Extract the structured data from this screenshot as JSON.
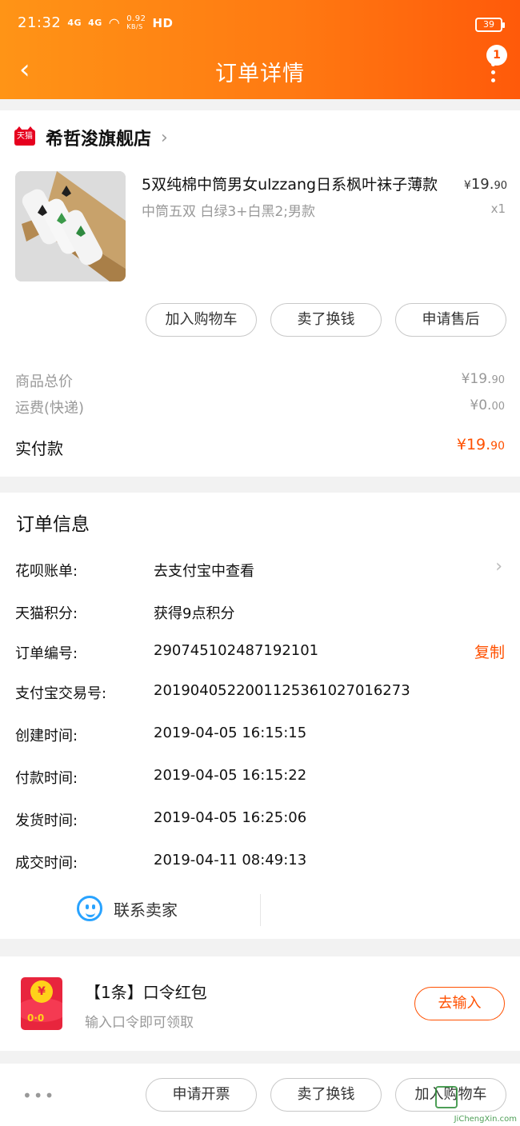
{
  "status_bar": {
    "time": "21:32",
    "signal1": "4G",
    "signal2": "4G",
    "net_speed_value": "0.92",
    "net_speed_unit": "KB/S",
    "hd": "HD",
    "battery": "39"
  },
  "header": {
    "title": "订单详情",
    "badge": "1"
  },
  "shop": {
    "tag": "天猫",
    "name": "希哲浚旗舰店"
  },
  "product": {
    "name": "5双纯棉中筒男女ulzzang日系枫叶袜子薄款",
    "sku": "中筒五双 白绿3+白黑2;男款",
    "price_symbol": "¥",
    "price_int": "19.",
    "price_dec": "90",
    "qty": "x1"
  },
  "product_actions": [
    "加入购物车",
    "卖了换钱",
    "申请售后"
  ],
  "summary": {
    "goods_label": "商品总价",
    "goods_int": "¥19.",
    "goods_dec": "90",
    "ship_label": "运费(快递)",
    "ship_int": "¥0.",
    "ship_dec": "00",
    "paid_label": "实付款",
    "paid_int": "¥19.",
    "paid_dec": "90"
  },
  "order_info": {
    "title": "订单信息",
    "rows": [
      {
        "label": "花呗账单:",
        "value": "去支付宝中查看"
      },
      {
        "label": "天猫积分:",
        "value": "获得9点积分"
      },
      {
        "label": "订单编号:",
        "value": "290745102487192101"
      },
      {
        "label": "支付宝交易号:",
        "value": "2019040522001125361027016273"
      },
      {
        "label": "创建时间:",
        "value": "2019-04-05 16:15:15"
      },
      {
        "label": "付款时间:",
        "value": "2019-04-05 16:15:22"
      },
      {
        "label": "发货时间:",
        "value": "2019-04-05 16:25:06"
      },
      {
        "label": "成交时间:",
        "value": "2019-04-11 08:49:13"
      }
    ],
    "copy_label": "复制",
    "contact_label": "联系卖家"
  },
  "red_packet": {
    "title": "【1条】口令红包",
    "subtitle": "输入口令即可领取",
    "button": "去输入",
    "coin": "¥",
    "face": "0·0"
  },
  "bottom_bar": {
    "dots": "•••",
    "buttons": [
      "申请开票",
      "卖了换钱",
      "加入购物车"
    ]
  },
  "watermark": {
    "text": "JiChengXin.com"
  },
  "colors": {
    "accent": "#ff5000",
    "header_start": "#ff9416",
    "header_end": "#ff5a0a",
    "contact_blue": "#29a3ff",
    "tmall_red": "#e6001e"
  }
}
